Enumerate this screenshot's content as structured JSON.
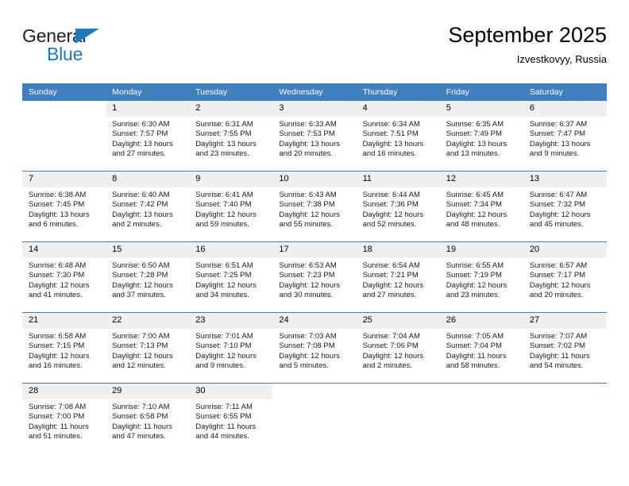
{
  "brand": {
    "line1": "General",
    "line2": "Blue",
    "accent_color": "#1f78c1",
    "text_color": "#231f20"
  },
  "header": {
    "title": "September 2025",
    "subtitle": "Izvestkovyy, Russia"
  },
  "theme": {
    "header_row_bg": "#3f7fbf",
    "header_row_text": "#ffffff",
    "day_band_bg": "#f0f0f0",
    "row_border": "#3f7fbf"
  },
  "weekdays": [
    "Sunday",
    "Monday",
    "Tuesday",
    "Wednesday",
    "Thursday",
    "Friday",
    "Saturday"
  ],
  "weeks": [
    [
      {
        "day": "",
        "sunrise": "",
        "sunset": "",
        "daylight": "",
        "empty": true
      },
      {
        "day": "1",
        "sunrise": "Sunrise: 6:30 AM",
        "sunset": "Sunset: 7:57 PM",
        "daylight": "Daylight: 13 hours and 27 minutes."
      },
      {
        "day": "2",
        "sunrise": "Sunrise: 6:31 AM",
        "sunset": "Sunset: 7:55 PM",
        "daylight": "Daylight: 13 hours and 23 minutes."
      },
      {
        "day": "3",
        "sunrise": "Sunrise: 6:33 AM",
        "sunset": "Sunset: 7:53 PM",
        "daylight": "Daylight: 13 hours and 20 minutes."
      },
      {
        "day": "4",
        "sunrise": "Sunrise: 6:34 AM",
        "sunset": "Sunset: 7:51 PM",
        "daylight": "Daylight: 13 hours and 16 minutes."
      },
      {
        "day": "5",
        "sunrise": "Sunrise: 6:35 AM",
        "sunset": "Sunset: 7:49 PM",
        "daylight": "Daylight: 13 hours and 13 minutes."
      },
      {
        "day": "6",
        "sunrise": "Sunrise: 6:37 AM",
        "sunset": "Sunset: 7:47 PM",
        "daylight": "Daylight: 13 hours and 9 minutes."
      }
    ],
    [
      {
        "day": "7",
        "sunrise": "Sunrise: 6:38 AM",
        "sunset": "Sunset: 7:45 PM",
        "daylight": "Daylight: 13 hours and 6 minutes."
      },
      {
        "day": "8",
        "sunrise": "Sunrise: 6:40 AM",
        "sunset": "Sunset: 7:42 PM",
        "daylight": "Daylight: 13 hours and 2 minutes."
      },
      {
        "day": "9",
        "sunrise": "Sunrise: 6:41 AM",
        "sunset": "Sunset: 7:40 PM",
        "daylight": "Daylight: 12 hours and 59 minutes."
      },
      {
        "day": "10",
        "sunrise": "Sunrise: 6:43 AM",
        "sunset": "Sunset: 7:38 PM",
        "daylight": "Daylight: 12 hours and 55 minutes."
      },
      {
        "day": "11",
        "sunrise": "Sunrise: 6:44 AM",
        "sunset": "Sunset: 7:36 PM",
        "daylight": "Daylight: 12 hours and 52 minutes."
      },
      {
        "day": "12",
        "sunrise": "Sunrise: 6:45 AM",
        "sunset": "Sunset: 7:34 PM",
        "daylight": "Daylight: 12 hours and 48 minutes."
      },
      {
        "day": "13",
        "sunrise": "Sunrise: 6:47 AM",
        "sunset": "Sunset: 7:32 PM",
        "daylight": "Daylight: 12 hours and 45 minutes."
      }
    ],
    [
      {
        "day": "14",
        "sunrise": "Sunrise: 6:48 AM",
        "sunset": "Sunset: 7:30 PM",
        "daylight": "Daylight: 12 hours and 41 minutes."
      },
      {
        "day": "15",
        "sunrise": "Sunrise: 6:50 AM",
        "sunset": "Sunset: 7:28 PM",
        "daylight": "Daylight: 12 hours and 37 minutes."
      },
      {
        "day": "16",
        "sunrise": "Sunrise: 6:51 AM",
        "sunset": "Sunset: 7:25 PM",
        "daylight": "Daylight: 12 hours and 34 minutes."
      },
      {
        "day": "17",
        "sunrise": "Sunrise: 6:53 AM",
        "sunset": "Sunset: 7:23 PM",
        "daylight": "Daylight: 12 hours and 30 minutes."
      },
      {
        "day": "18",
        "sunrise": "Sunrise: 6:54 AM",
        "sunset": "Sunset: 7:21 PM",
        "daylight": "Daylight: 12 hours and 27 minutes."
      },
      {
        "day": "19",
        "sunrise": "Sunrise: 6:55 AM",
        "sunset": "Sunset: 7:19 PM",
        "daylight": "Daylight: 12 hours and 23 minutes."
      },
      {
        "day": "20",
        "sunrise": "Sunrise: 6:57 AM",
        "sunset": "Sunset: 7:17 PM",
        "daylight": "Daylight: 12 hours and 20 minutes."
      }
    ],
    [
      {
        "day": "21",
        "sunrise": "Sunrise: 6:58 AM",
        "sunset": "Sunset: 7:15 PM",
        "daylight": "Daylight: 12 hours and 16 minutes."
      },
      {
        "day": "22",
        "sunrise": "Sunrise: 7:00 AM",
        "sunset": "Sunset: 7:13 PM",
        "daylight": "Daylight: 12 hours and 12 minutes."
      },
      {
        "day": "23",
        "sunrise": "Sunrise: 7:01 AM",
        "sunset": "Sunset: 7:10 PM",
        "daylight": "Daylight: 12 hours and 9 minutes."
      },
      {
        "day": "24",
        "sunrise": "Sunrise: 7:03 AM",
        "sunset": "Sunset: 7:08 PM",
        "daylight": "Daylight: 12 hours and 5 minutes."
      },
      {
        "day": "25",
        "sunrise": "Sunrise: 7:04 AM",
        "sunset": "Sunset: 7:06 PM",
        "daylight": "Daylight: 12 hours and 2 minutes."
      },
      {
        "day": "26",
        "sunrise": "Sunrise: 7:05 AM",
        "sunset": "Sunset: 7:04 PM",
        "daylight": "Daylight: 11 hours and 58 minutes."
      },
      {
        "day": "27",
        "sunrise": "Sunrise: 7:07 AM",
        "sunset": "Sunset: 7:02 PM",
        "daylight": "Daylight: 11 hours and 54 minutes."
      }
    ],
    [
      {
        "day": "28",
        "sunrise": "Sunrise: 7:08 AM",
        "sunset": "Sunset: 7:00 PM",
        "daylight": "Daylight: 11 hours and 51 minutes."
      },
      {
        "day": "29",
        "sunrise": "Sunrise: 7:10 AM",
        "sunset": "Sunset: 6:58 PM",
        "daylight": "Daylight: 11 hours and 47 minutes."
      },
      {
        "day": "30",
        "sunrise": "Sunrise: 7:11 AM",
        "sunset": "Sunset: 6:55 PM",
        "daylight": "Daylight: 11 hours and 44 minutes."
      },
      {
        "day": "",
        "sunrise": "",
        "sunset": "",
        "daylight": "",
        "empty": true
      },
      {
        "day": "",
        "sunrise": "",
        "sunset": "",
        "daylight": "",
        "empty": true
      },
      {
        "day": "",
        "sunrise": "",
        "sunset": "",
        "daylight": "",
        "empty": true
      },
      {
        "day": "",
        "sunrise": "",
        "sunset": "",
        "daylight": "",
        "empty": true
      }
    ]
  ]
}
